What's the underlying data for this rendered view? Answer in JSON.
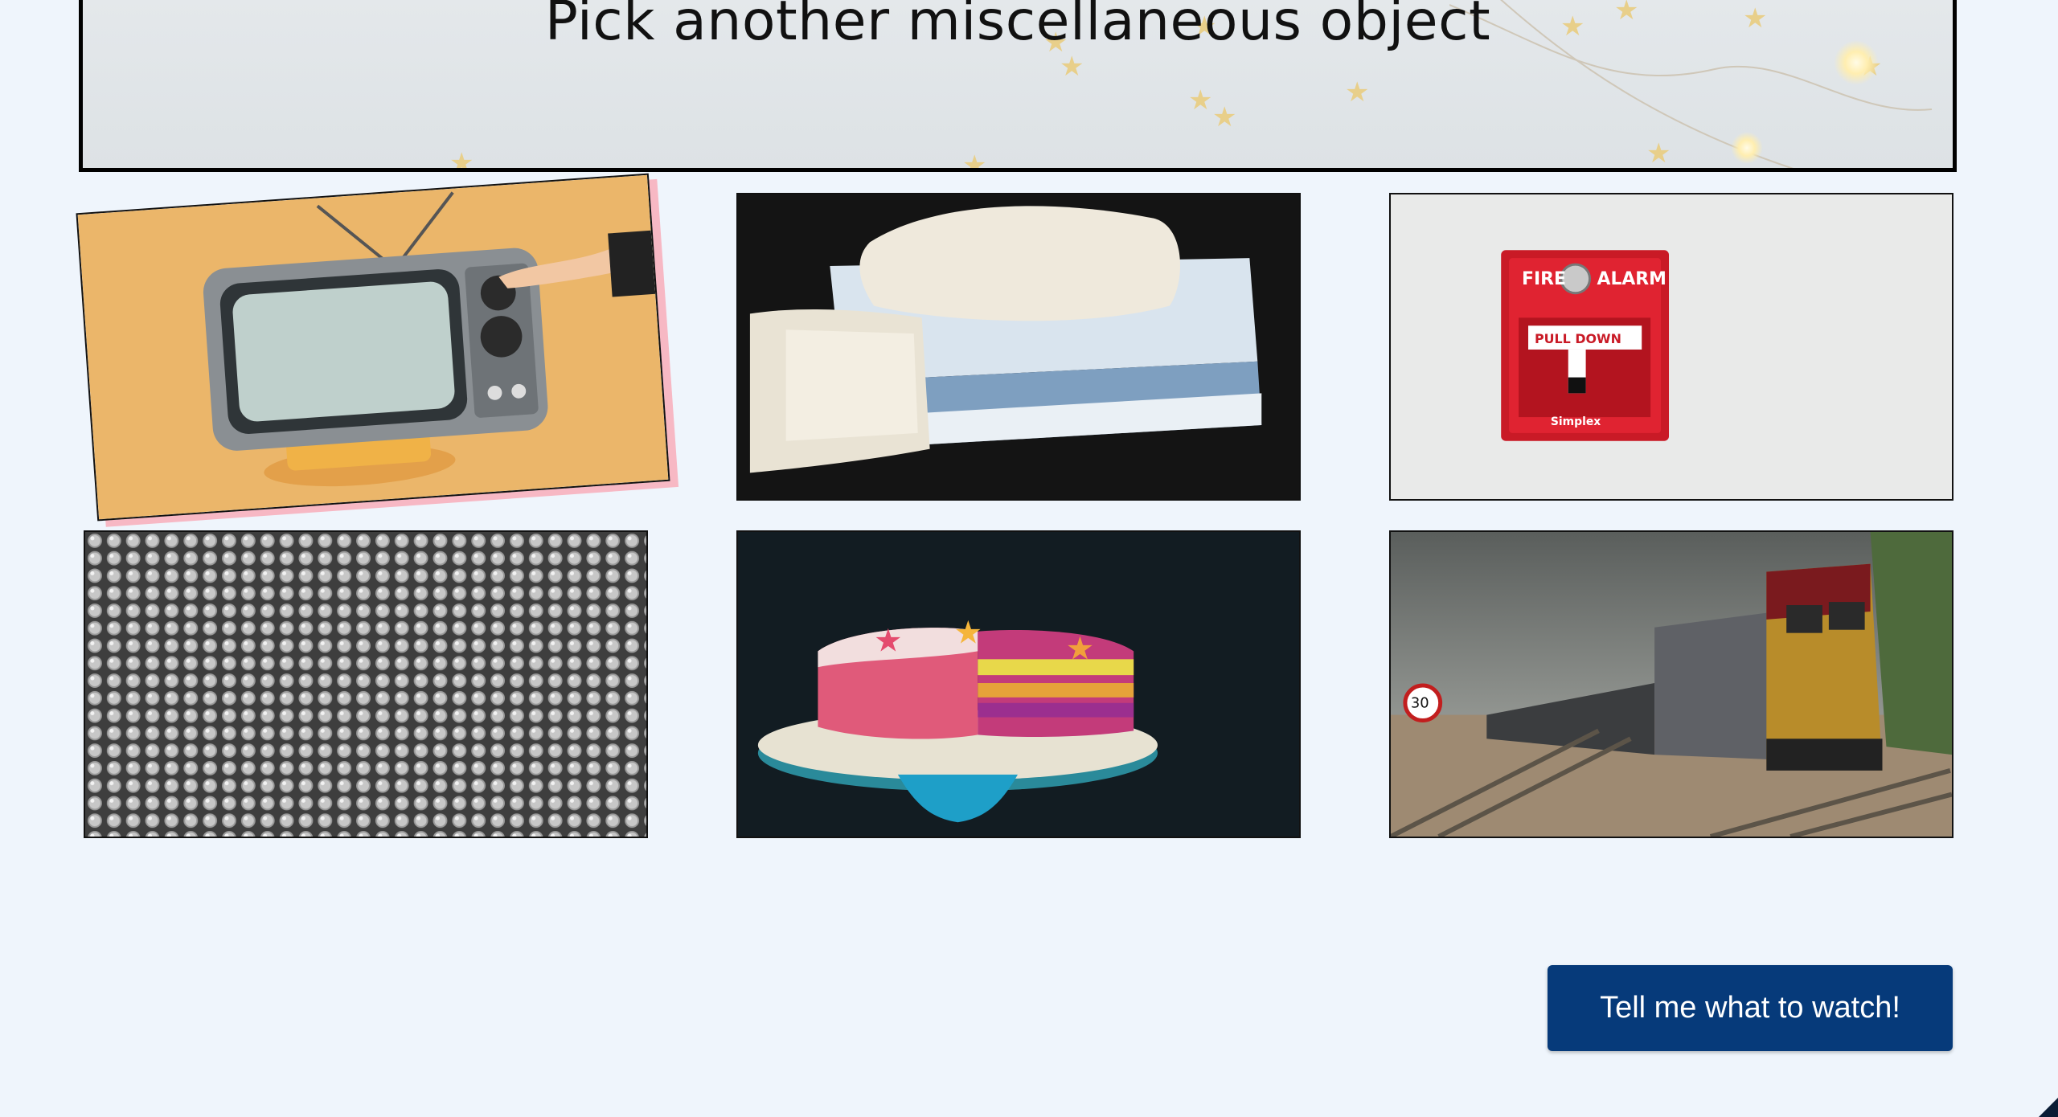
{
  "banner": {
    "title": "Pick another miscellaneous object"
  },
  "tiles": [
    {
      "icon": "retro-television-image",
      "selected": true
    },
    {
      "icon": "tissue-box-image",
      "selected": false
    },
    {
      "icon": "fire-alarm-image",
      "selected": false,
      "texts": {
        "fire": "FIRE",
        "alarm": "ALARM",
        "pull": "PULL  DOWN",
        "brand": "Simplex"
      }
    },
    {
      "icon": "bubble-wrap-image",
      "selected": false
    },
    {
      "icon": "cake-image",
      "selected": false
    },
    {
      "icon": "freight-train-image",
      "selected": false,
      "texts": {
        "sign": "30"
      }
    }
  ],
  "action": {
    "watch_label": "Tell me what to watch!"
  },
  "colors": {
    "background": "#eff5fc",
    "button": "#063a7a",
    "selected_shadow": "#f7b8c4"
  }
}
